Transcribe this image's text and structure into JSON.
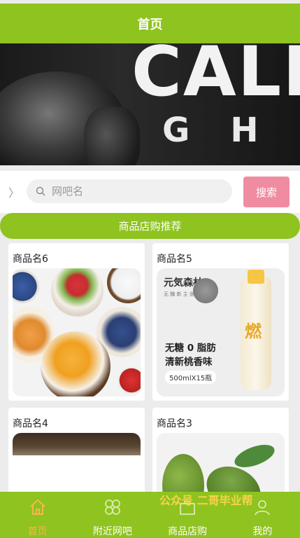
{
  "header": {
    "title": "首页"
  },
  "banner": {
    "big_text": "CALL",
    "small_text": "GH"
  },
  "search": {
    "chevron": "〉",
    "placeholder": "网吧名",
    "button_label": "搜索",
    "icon": "search-icon"
  },
  "section": {
    "title": "商品店购推荐"
  },
  "products": [
    {
      "name": "商品名6"
    },
    {
      "name": "商品名5"
    },
    {
      "name": "商品名4"
    },
    {
      "name": "商品名3"
    }
  ],
  "drink_ad": {
    "brand": "元気森林",
    "sub": "无 糖 新 主 张",
    "bottle_char": "燃",
    "line1": "无糖 0 脂肪",
    "line2": "清新桃香味",
    "spec": "500mlX15瓶"
  },
  "nav": [
    {
      "label": "首页",
      "icon": "home-icon",
      "active": true
    },
    {
      "label": "附近网吧",
      "icon": "nearby-icon",
      "active": false
    },
    {
      "label": "商品店购",
      "icon": "shop-icon",
      "active": false
    },
    {
      "label": "我的",
      "icon": "user-icon",
      "active": false
    }
  ],
  "watermark": "公众号 二哥毕业帮",
  "colors": {
    "primary": "#8fc31f",
    "search_button": "#f08ca2",
    "active_nav": "#f5b84a",
    "watermark": "#f8d34a"
  }
}
